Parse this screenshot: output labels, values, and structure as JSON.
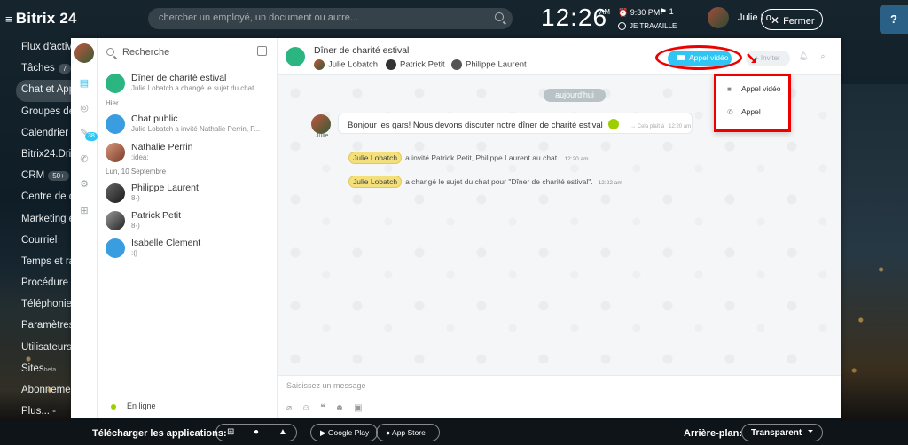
{
  "app": {
    "logo": "Bitrix 24"
  },
  "header": {
    "search_placeholder": "chercher un employé, un document ou autre...",
    "clock": "12:26",
    "ampm": "AM",
    "alarm": "⏰ 9:30 PM",
    "flag": "⚑ 1",
    "status": "JE TRAVAILLE",
    "user_name": "Julie Lo",
    "close_label": "Fermer",
    "help": "?"
  },
  "menu": {
    "items": [
      {
        "label": "Flux d'activi"
      },
      {
        "label": "Tâches",
        "badge": "7"
      },
      {
        "label": "Chat et App"
      },
      {
        "label": "Groupes de"
      },
      {
        "label": "Calendrier"
      },
      {
        "label": "Bitrix24.Driv"
      },
      {
        "label": "CRM",
        "badge": "50+"
      },
      {
        "label": "Centre de c"
      },
      {
        "label": "Marketing e"
      },
      {
        "label": "Courriel"
      },
      {
        "label": "Temps et ra"
      },
      {
        "label": "Procédure d"
      },
      {
        "label": "Téléphonie"
      },
      {
        "label": "Paramètres"
      },
      {
        "label": "Utilisateurs"
      },
      {
        "label": "Sites",
        "beta": "beta"
      },
      {
        "label": "Abonneme"
      },
      {
        "label": "Plus... -"
      }
    ]
  },
  "rail": {
    "counter": "38"
  },
  "recent": {
    "search_label": "Recherche",
    "sections": {
      "yesterday": "Hier",
      "date": "Lun, 10 Septembre"
    },
    "chats": [
      {
        "title": "Dîner de charité estival",
        "sub": "Julie Lobatch a changé le sujet du chat ..."
      },
      {
        "title": "Chat public",
        "sub": "Julie Lobatch a invité Nathalie Perrin, P..."
      },
      {
        "title": "Nathalie Perrin",
        "sub": ":idea:"
      },
      {
        "title": "Philippe Laurent",
        "sub": "8-)"
      },
      {
        "title": "Patrick Petit",
        "sub": "8-)"
      },
      {
        "title": "Isabelle Clement",
        "sub": ":(|"
      }
    ],
    "online_label": "En ligne"
  },
  "chat": {
    "title": "Dîner de charité estival",
    "participants": [
      "Julie Lobatch",
      "Patrick Petit",
      "Philippe Laurent"
    ],
    "video_call_label": "Appel vidéo",
    "invite_label": "Inviter",
    "menu_options": [
      "Appel vidéo",
      "Appel"
    ],
    "day_label": "aujourd'hui",
    "message": {
      "author_short": "Julie",
      "text": "Bonjour les gars! Nous devons discuter notre dîner de charité estival",
      "meta": "Cela plaît à",
      "time": "12:20 am"
    },
    "system_messages": [
      {
        "tag": "Julie Lobatch",
        "text": "a invité Patrick Petit, Philippe Laurent au chat.",
        "time": "12:20 am"
      },
      {
        "tag": "Julie Lobatch",
        "text": "a changé le sujet du chat pour \"Dîner de charité estival\".",
        "time": "12:22 am"
      }
    ],
    "input_placeholder": "Saisissez un message"
  },
  "bottom": {
    "download_label": "Télécharger les applications:",
    "google_play": "Google Play",
    "app_store": "App Store",
    "background_label": "Arrière-plan:",
    "background_value": "Transparent"
  },
  "colors": {
    "accent": "#2fc6f6",
    "highlight": "#e00000",
    "online": "#9dcf00"
  }
}
